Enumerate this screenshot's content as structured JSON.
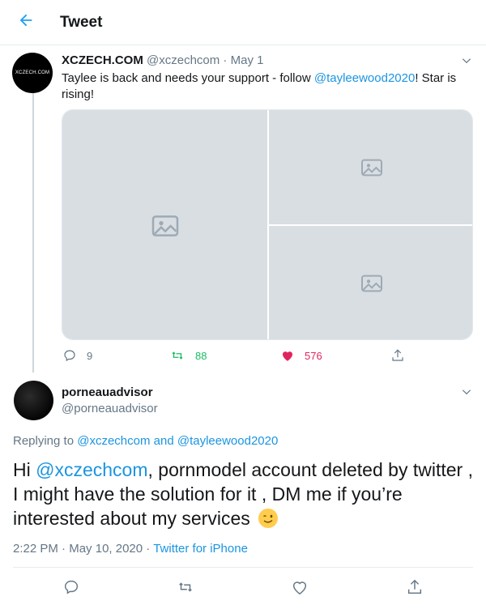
{
  "header": {
    "title": "Tweet",
    "back_icon": "arrow-left-icon"
  },
  "tweet1": {
    "avatar_text": "XCZECH.COM",
    "display_name": "XCZECH.COM",
    "handle": "@xczechcom",
    "separator": " · ",
    "date": "May 1",
    "text_before": "Taylee is back and needs your support - follow ",
    "mention": "@tayleewood2020",
    "text_after": "! Star is rising!",
    "media_count": 3,
    "actions": {
      "replies": "9",
      "retweets": "88",
      "likes": "576"
    },
    "colors": {
      "retweet": "#17bf63",
      "like": "#e0245e",
      "icon": "#657786"
    }
  },
  "tweet2": {
    "display_name": "porneauadvisor",
    "handle": "@porneauadvisor",
    "replying_label": "Replying to ",
    "replying_user1": "@xczechcom",
    "replying_and": " and ",
    "replying_user2": "@tayleewood2020",
    "text_prefix": "Hi ",
    "text_mention": "@xczechcom",
    "text_body": ", pornmodel account deleted by twitter , I might have the solution for it , DM me if you’re interested about my services",
    "emoji": "winking-face-icon",
    "time": "2:22 PM",
    "meta_sep": " · ",
    "date": "May 10, 2020",
    "source": "Twitter for iPhone"
  },
  "colors": {
    "accent": "#1da1f2",
    "link": "#1b95e0",
    "muted": "#657786"
  }
}
